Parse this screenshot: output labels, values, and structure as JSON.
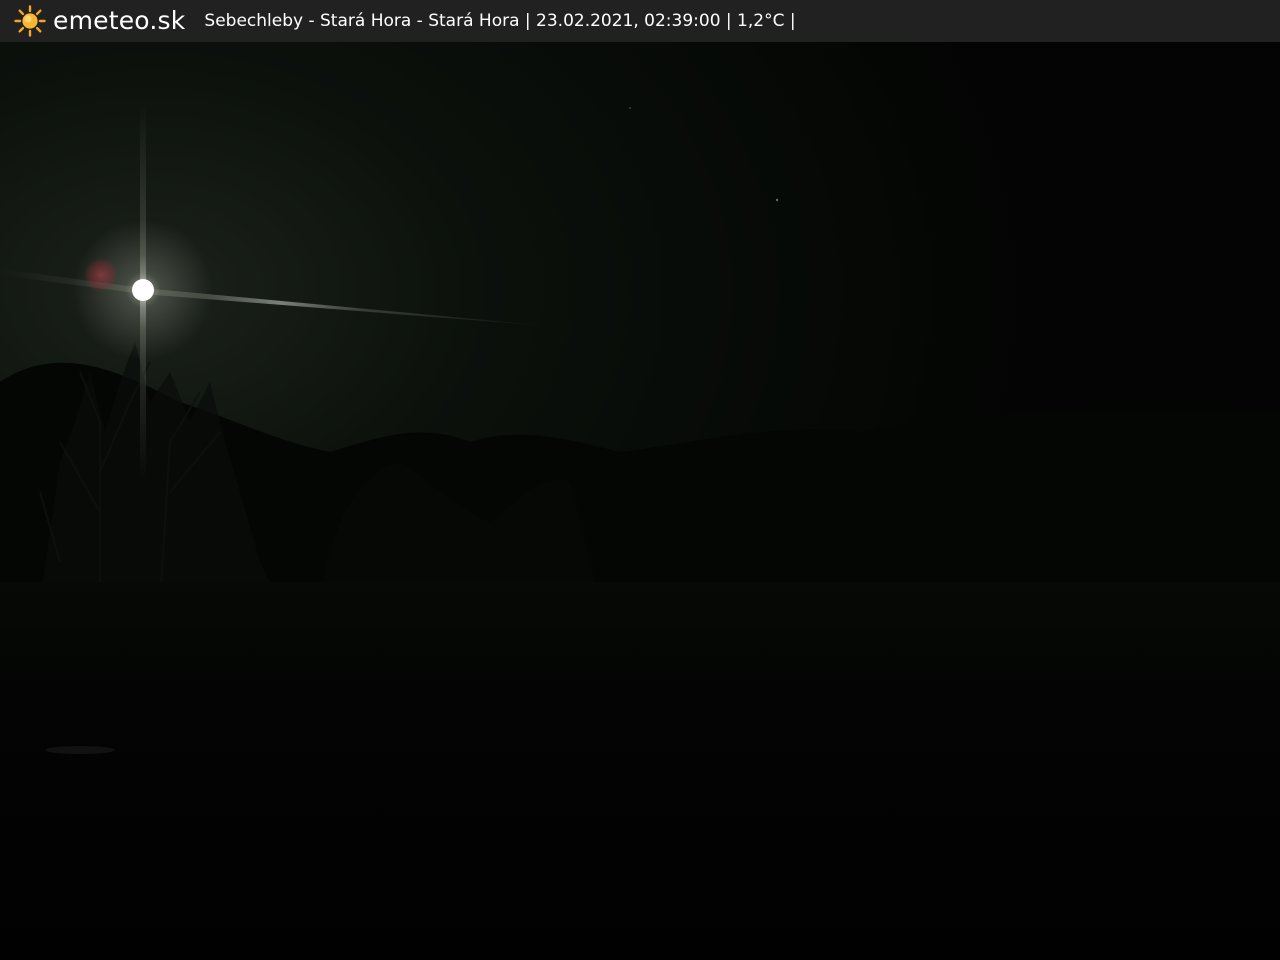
{
  "header": {
    "brand": "emeteo.sk",
    "brand_icon": "sun-icon",
    "brand_icon_color": "#f5a623",
    "caption": "Sebechleby - Stará Hora - Stará Hora | 23.02.2021, 02:39:00 | 1,2°C |"
  },
  "colors": {
    "bar_background": "#212121",
    "sky": "#060906"
  }
}
